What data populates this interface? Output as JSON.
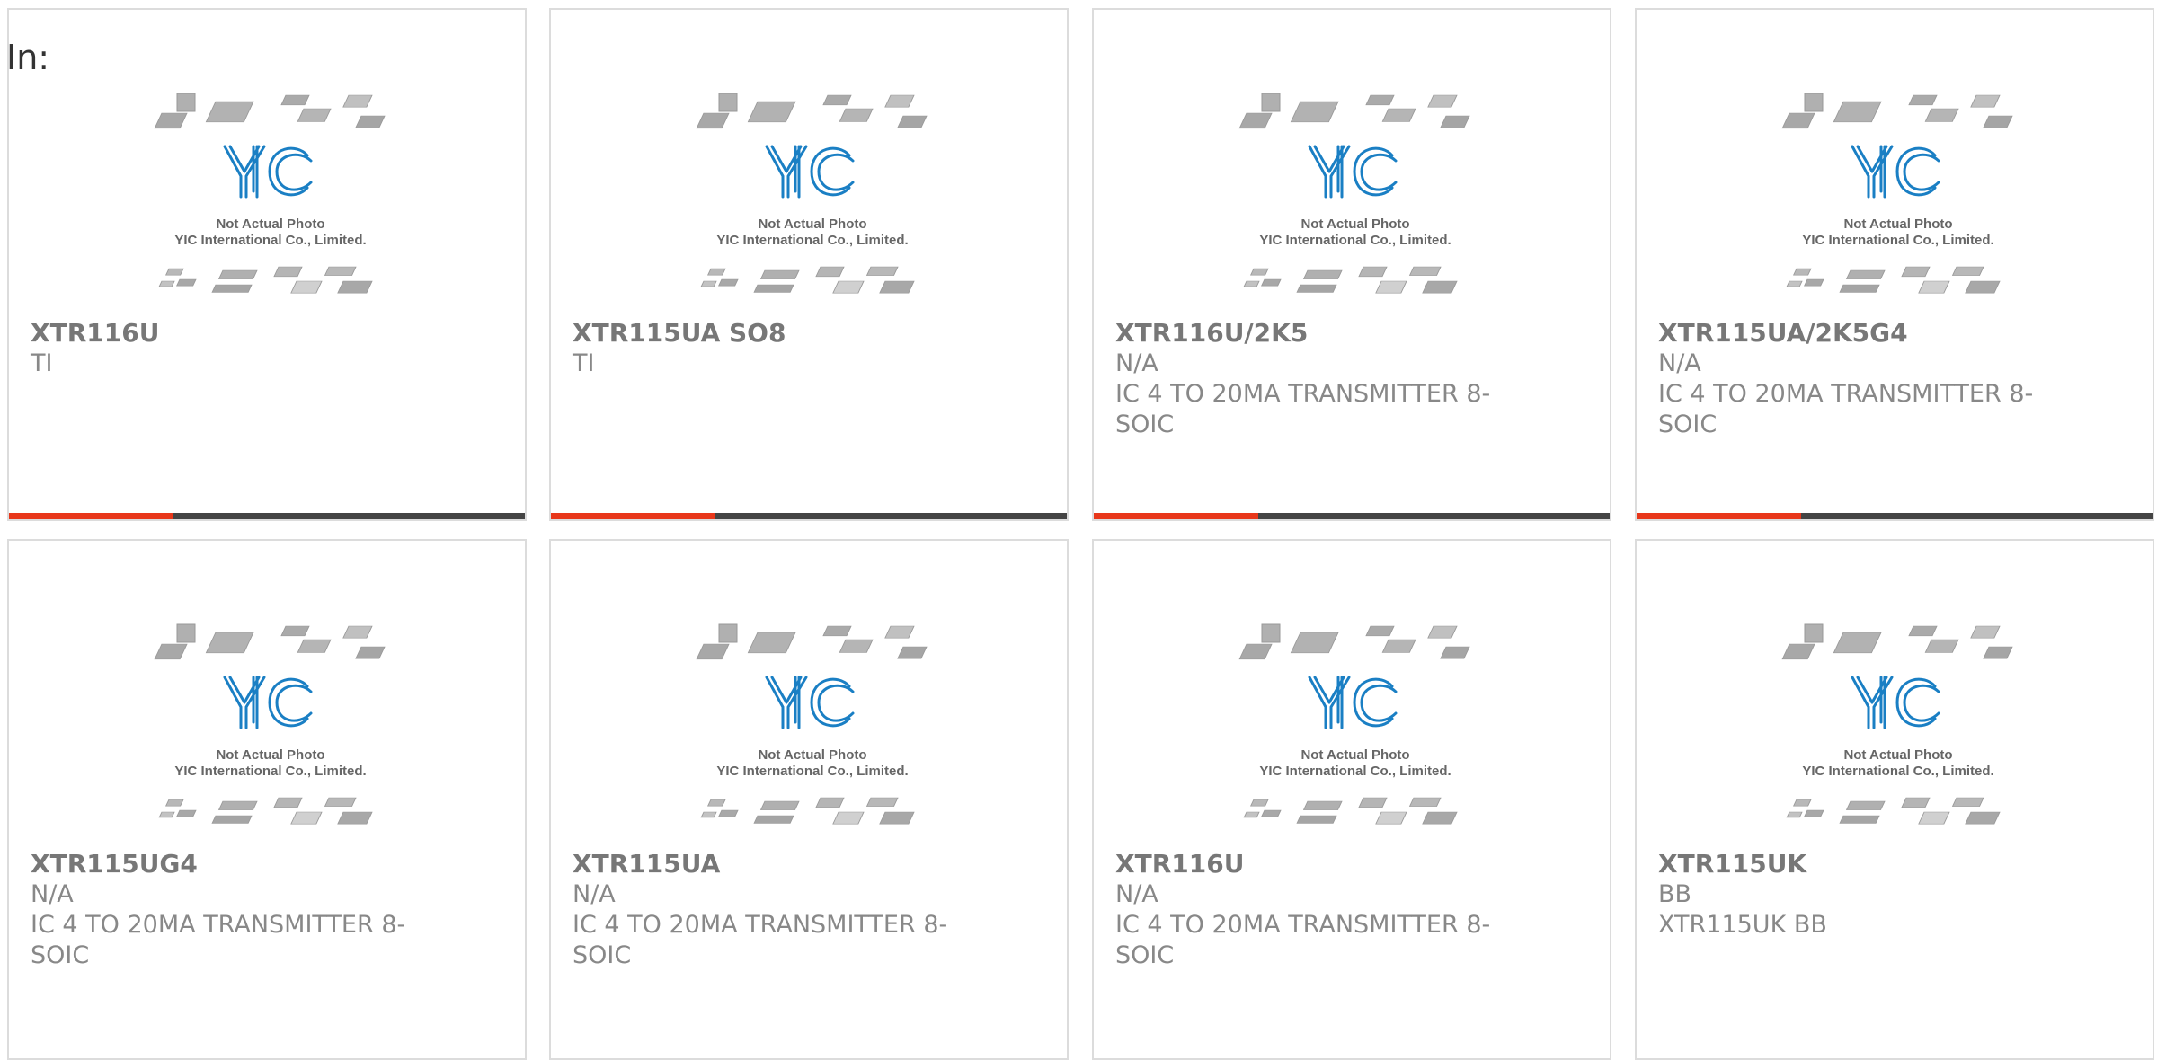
{
  "header": {
    "label": "In:"
  },
  "image": {
    "logo_text": "YIC",
    "caption_line1": "Not Actual Photo",
    "caption_line2": "YIC International Co., Limited."
  },
  "colors": {
    "accent": "#e8371a",
    "bar": "#444444",
    "logo": "#1a7fc4"
  },
  "products": [
    {
      "part_number": "XTR116U",
      "manufacturer": "TI",
      "description": ""
    },
    {
      "part_number": "XTR115UA SO8",
      "manufacturer": "TI",
      "description": ""
    },
    {
      "part_number": "XTR116U/2K5",
      "manufacturer": "N/A",
      "description": "IC 4 TO 20MA TRANSMITTER 8-SOIC"
    },
    {
      "part_number": "XTR115UA/2K5G4",
      "manufacturer": "N/A",
      "description": "IC 4 TO 20MA TRANSMITTER 8-SOIC"
    },
    {
      "part_number": "XTR115UG4",
      "manufacturer": "N/A",
      "description": "IC 4 TO 20MA TRANSMITTER 8-SOIC"
    },
    {
      "part_number": "XTR115UA",
      "manufacturer": "N/A",
      "description": "IC 4 TO 20MA TRANSMITTER 8-SOIC"
    },
    {
      "part_number": "XTR116U",
      "manufacturer": "N/A",
      "description": "IC 4 TO 20MA TRANSMITTER 8-SOIC"
    },
    {
      "part_number": "XTR115UK",
      "manufacturer": "BB",
      "description": "XTR115UK BB"
    }
  ]
}
